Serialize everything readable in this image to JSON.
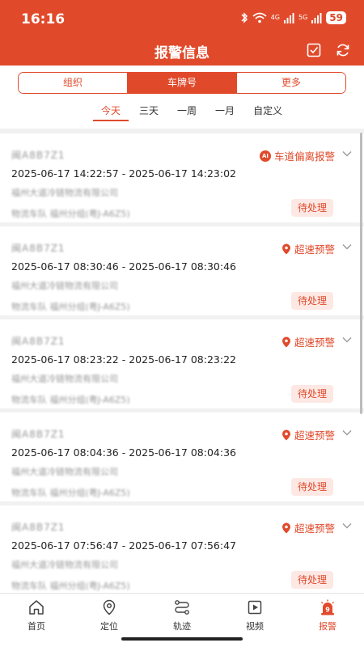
{
  "status_bar": {
    "time": "16:16",
    "battery": "59",
    "net1": "4G",
    "net2": "5G"
  },
  "header": {
    "title": "报警信息",
    "check_icon": "checkbox-icon",
    "refresh_icon": "refresh-icon"
  },
  "segments": [
    {
      "label": "组织",
      "active": false
    },
    {
      "label": "车牌号",
      "active": true
    },
    {
      "label": "更多",
      "active": false
    }
  ],
  "time_tabs": [
    {
      "label": "今天",
      "active": true
    },
    {
      "label": "三天",
      "active": false
    },
    {
      "label": "一周",
      "active": false
    },
    {
      "label": "一月",
      "active": false
    },
    {
      "label": "自定义",
      "active": false
    }
  ],
  "alarms": [
    {
      "plate": "闽A8B7Z1",
      "time_range": "2025-06-17 14:22:57 - 2025-06-17 14:23:02",
      "company": "福州大道冷链物流有限公司",
      "group": "物流车队 福州分组(粤J-A6Z5)",
      "type": "车道偏离报警",
      "icon": "ai-badge",
      "status": "待处理"
    },
    {
      "plate": "闽A8B7Z1",
      "time_range": "2025-06-17 08:30:46 - 2025-06-17 08:30:46",
      "company": "福州大道冷链物流有限公司",
      "group": "物流车队 福州分组(粤J-A6Z5)",
      "type": "超速预警",
      "icon": "location-pin-icon",
      "status": "待处理"
    },
    {
      "plate": "闽A8B7Z1",
      "time_range": "2025-06-17 08:23:22 - 2025-06-17 08:23:22",
      "company": "福州大道冷链物流有限公司",
      "group": "物流车队 福州分组(粤J-A6Z5)",
      "type": "超速预警",
      "icon": "location-pin-icon",
      "status": "待处理"
    },
    {
      "plate": "闽A8B7Z1",
      "time_range": "2025-06-17 08:04:36 - 2025-06-17 08:04:36",
      "company": "福州大道冷链物流有限公司",
      "group": "物流车队 福州分组(粤J-A6Z5)",
      "type": "超速预警",
      "icon": "location-pin-icon",
      "status": "待处理"
    },
    {
      "plate": "闽A8B7Z1",
      "time_range": "2025-06-17 07:56:47 - 2025-06-17 07:56:47",
      "company": "福州大道冷链物流有限公司",
      "group": "物流车队 福州分组(粤J-A6Z5)",
      "type": "超速预警",
      "icon": "location-pin-icon",
      "status": "待处理"
    }
  ],
  "ai_label": "AI",
  "tabbar": [
    {
      "label": "首页",
      "icon": "home-icon",
      "active": false
    },
    {
      "label": "定位",
      "icon": "location-icon",
      "active": false
    },
    {
      "label": "轨迹",
      "icon": "track-icon",
      "active": false
    },
    {
      "label": "视频",
      "icon": "video-icon",
      "active": false
    },
    {
      "label": "报警",
      "icon": "alarm-icon",
      "active": true
    }
  ],
  "alarm_badge": "9",
  "colors": {
    "accent": "#e04a2b",
    "tag_bg": "#fde8e4"
  }
}
